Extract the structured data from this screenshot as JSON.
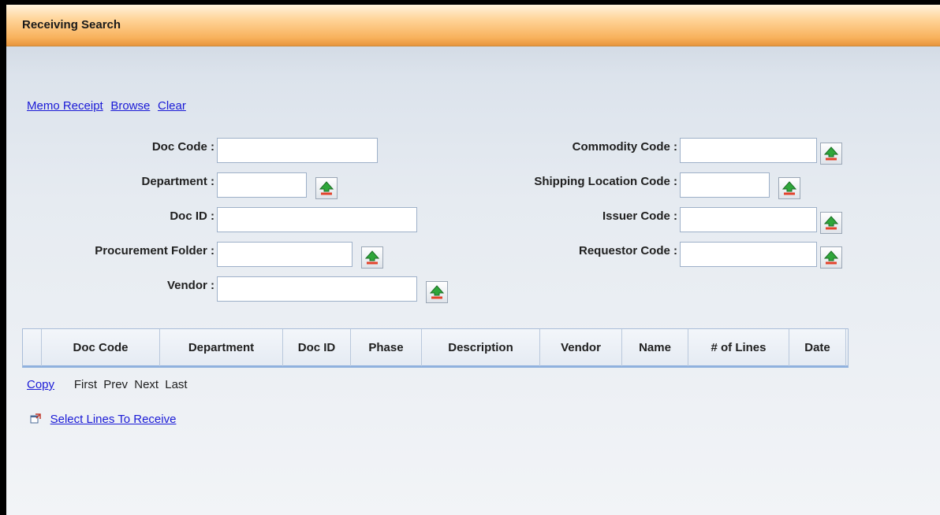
{
  "header": {
    "title": "Receiving Search"
  },
  "toolbar": {
    "memo_receipt": "Memo Receipt",
    "browse": "Browse",
    "clear": "Clear"
  },
  "form": {
    "doc_code": {
      "label": "Doc Code :",
      "value": ""
    },
    "department": {
      "label": "Department :",
      "value": ""
    },
    "doc_id": {
      "label": "Doc ID :",
      "value": ""
    },
    "procurement_folder": {
      "label": "Procurement Folder :",
      "value": ""
    },
    "vendor": {
      "label": "Vendor :",
      "value": ""
    },
    "commodity_code": {
      "label": "Commodity Code :",
      "value": ""
    },
    "shipping_location_code": {
      "label": "Shipping Location Code :",
      "value": ""
    },
    "issuer_code": {
      "label": "Issuer Code :",
      "value": ""
    },
    "requestor_code": {
      "label": "Requestor Code :",
      "value": ""
    }
  },
  "grid": {
    "columns": [
      "Doc Code",
      "Department",
      "Doc ID",
      "Phase",
      "Description",
      "Vendor",
      "Name",
      "# of Lines",
      "Date"
    ]
  },
  "pager": {
    "copy": "Copy",
    "first": "First",
    "prev": "Prev",
    "next": "Next",
    "last": "Last"
  },
  "actions": {
    "select_lines": "Select Lines To Receive"
  },
  "icons": {
    "lookup": "lookup-arrow-icon",
    "popup": "open-window-icon"
  },
  "colors": {
    "link": "#1a1ad6",
    "title_bar": "#f8b25d",
    "grid_border": "#8fb1de"
  }
}
